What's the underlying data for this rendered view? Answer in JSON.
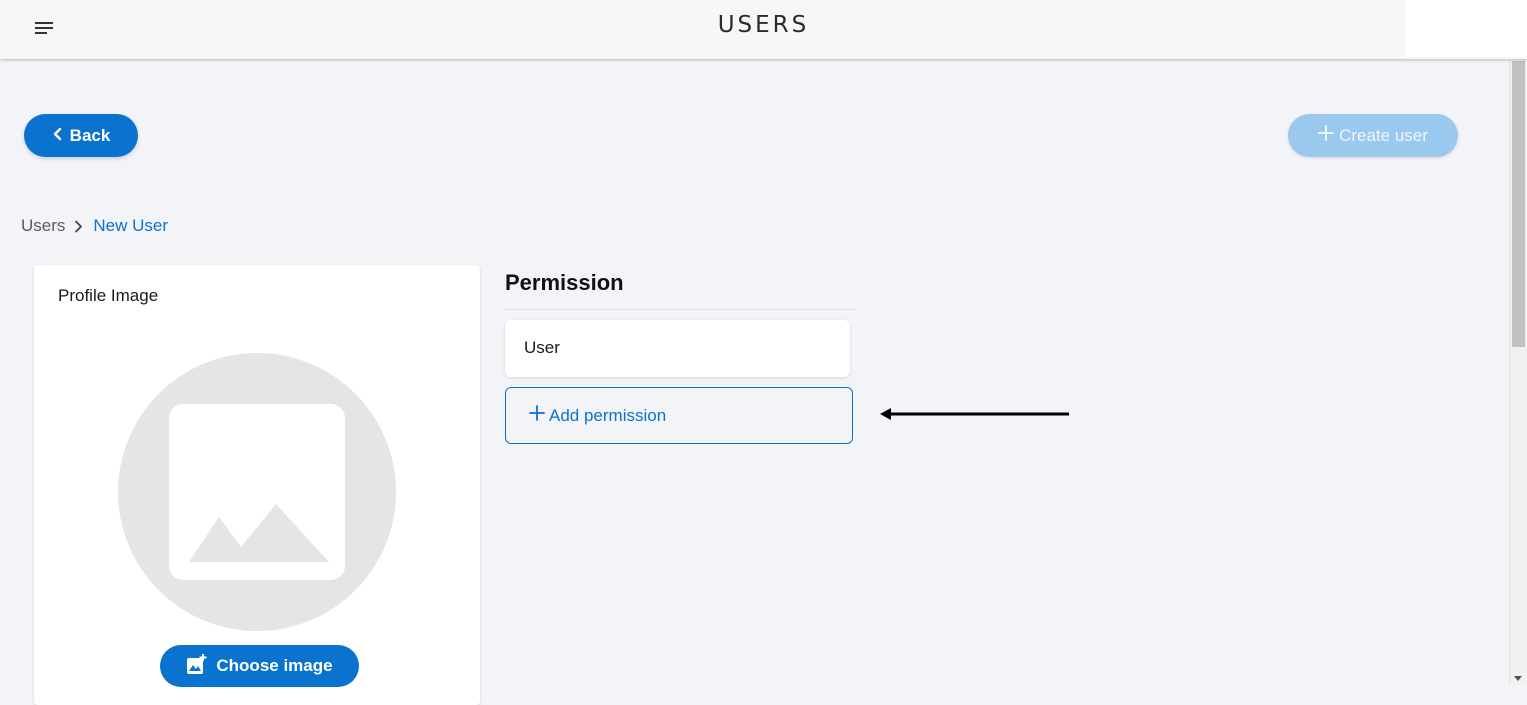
{
  "app": {
    "title": "USERS"
  },
  "icons": {
    "menu": "menu-lines-icon",
    "back": "chevron-left-icon",
    "create": "plus-icon",
    "breadcrumb_separator": "chevron-right-icon",
    "placeholder": "image-placeholder-icon",
    "choose_image": "add-photo-icon",
    "add_permission": "plus-icon",
    "annotation": "left-arrow-icon"
  },
  "toolbar": {
    "back_label": "Back",
    "create_label": "Create user"
  },
  "breadcrumb": {
    "root": "Users",
    "current": "New User"
  },
  "profile": {
    "title": "Profile Image",
    "choose_label": "Choose image"
  },
  "permission": {
    "heading": "Permission",
    "items": [
      {
        "label": "User"
      }
    ],
    "add_label": "Add permission"
  },
  "colors": {
    "primary": "#0a73cf",
    "primary_disabled": "#9ac8ef",
    "background": "#f3f4f8"
  }
}
